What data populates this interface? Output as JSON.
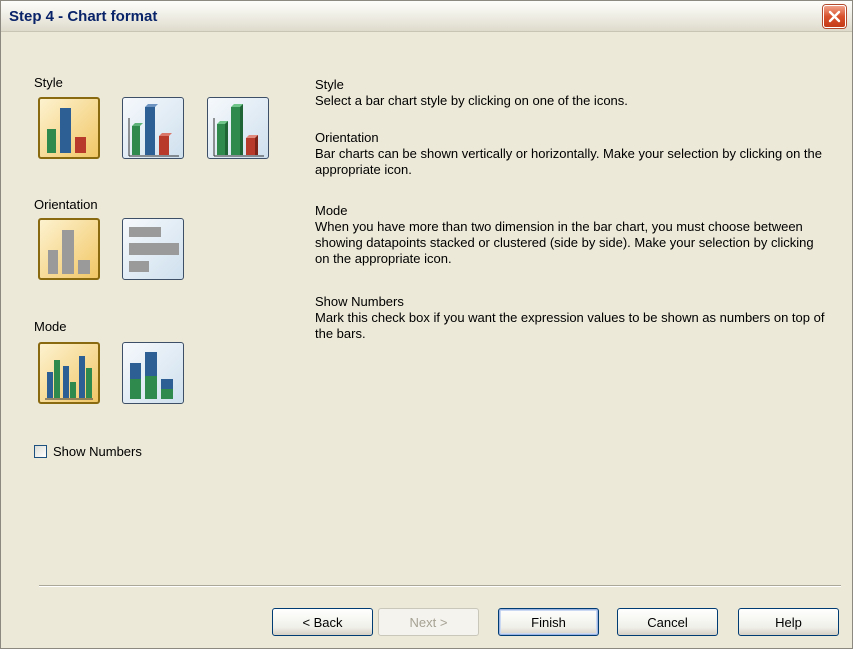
{
  "window": {
    "title": "Step 4 - Chart format",
    "close_icon": "close-icon"
  },
  "left": {
    "style_label": "Style",
    "orientation_label": "Orientation",
    "mode_label": "Mode",
    "show_numbers_label": "Show Numbers",
    "show_numbers_checked": false
  },
  "style_options": [
    {
      "icon": "bar-chart-flat-icon",
      "selected": true
    },
    {
      "icon": "bar-chart-3d-icon",
      "selected": false
    },
    {
      "icon": "bar-chart-3d-shaded-icon",
      "selected": false
    }
  ],
  "orientation_options": [
    {
      "icon": "vertical-bars-icon",
      "selected": true
    },
    {
      "icon": "horizontal-bars-icon",
      "selected": false
    }
  ],
  "mode_options": [
    {
      "icon": "clustered-bars-icon",
      "selected": true
    },
    {
      "icon": "stacked-bars-icon",
      "selected": false
    }
  ],
  "help": {
    "style_title": "Style",
    "style_text": "Select a bar chart style by clicking on one of the icons.",
    "orientation_title": "Orientation",
    "orientation_text": "Bar charts can be shown vertically or horizontally. Make your selection by clicking on the appropriate icon.",
    "mode_title": "Mode",
    "mode_text": "When you have more than two dimension in the bar chart, you must choose between showing datapoints stacked or clustered (side by side). Make your selection by clicking on the appropriate icon.",
    "numbers_title": "Show Numbers",
    "numbers_text": "Mark this check box if you want the expression values to be shown as numbers on top of the bars."
  },
  "buttons": {
    "back": "< Back",
    "next": "Next >",
    "finish": "Finish",
    "cancel": "Cancel",
    "help": "Help"
  },
  "colors": {
    "bar_blue": "#2e5f94",
    "bar_green": "#2f8a4e",
    "bar_red": "#b83a2a",
    "bar_gray": "#9a9a9a",
    "selected_bg": "#f1c766"
  }
}
